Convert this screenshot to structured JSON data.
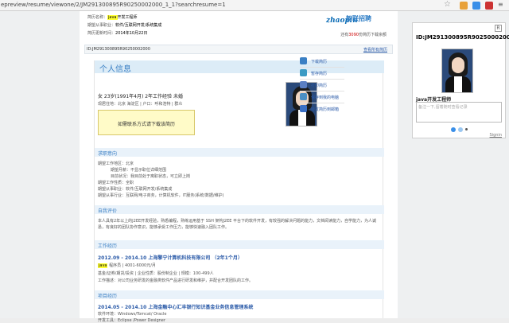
{
  "browser": {
    "url": "epreview/resume/viewone/2/JM291300895R90250002000_1_1?searchresume=1",
    "extension_colors": [
      "#e8a13a",
      "#3a8fe8",
      "#c33"
    ]
  },
  "header": {
    "position_name_label": "简历名称：",
    "position_name_hl": "java",
    "position_name_rest": "开发工程师",
    "intended_label": "期望从事职业：",
    "intended_value": "软件/互联网开发/系统集成",
    "updated_label": "简历更新时间：",
    "updated_value": "2014年10月22日",
    "logo_text": "zhaopin",
    "logo_cn": "智联招聘",
    "more_text_pre": "还有",
    "more_count": "3090",
    "more_text_post": "份简历下载余额"
  },
  "idbar": {
    "id_text": "ID:JM291300895R90250002000",
    "all_link": "查看所有简历"
  },
  "resume": {
    "title": "个人信息",
    "basic_line": "女  23岁(1991年4月)  2年工作经验  未婚",
    "location_line": "现居住地：北京 海淀区 | 户口：呼和浩特 | 群众",
    "contact_text": "如需联系方式请下载该简历",
    "sections": {
      "intent": "求职意向",
      "self_eval": "自我评价",
      "work": "工作经历",
      "project": "项目经历"
    },
    "intent_lines": [
      "期望工作地区：北京",
      "期望月薪：不显示职位详细范围",
      "目前状况：我目前处于离职状态，可立即上岗",
      "期望工作性质：全职",
      "期望从事职业：软件/互联网开发/系统集成",
      "期望从事行业：互联网/电子商务，计算机软件，IT服务(系统/数据/维护)"
    ],
    "self_eval_text": "本人具有2年以上的J2EE开发经验，熟悉编程，熟练运用基于 SSH 架构J2EE 平台下的软件开发，有较强的解决问题的能力，文档阅读能力，自学能力，为人诚恳，有良好的团队协作意识，能够承受工作压力，能够快速融入团队工作。",
    "job_title": "2012.09 - 2014.10  上海擎宁计算机科技有限公司  （2年1个月）",
    "job_hl": "java",
    "job_sub": "程序员 | 4001-6000元/月",
    "job_meta": "基金/证券/期货/投资 | 企业性质：股份制企业 | 规模：100-499人",
    "job_desc": "工作描述：对公司业务研发的金融类软件产品进行研发和维护，并配合开发团队的工作。",
    "project_title": "2014.05 - 2014.10  上海金融中心汇丰银行知识基金业务信息管理系统",
    "project_env": "软件环境：Windows/Tomcat/ Oracle",
    "project_tools": "开发工具：Eclipse /Power Designer"
  },
  "toolbar": {
    "items": [
      "下载简历",
      "暂存简历",
      "打印简历",
      "保存到我的电脑",
      "转发简历到邮箱"
    ],
    "icon_colors": [
      "#3a7fc4",
      "#3a9ac4",
      "#5a7fc4",
      "#4a8fc4",
      "#3a6fc4"
    ]
  },
  "side_card": {
    "r_label": "R",
    "id": "ID:JM291300895R90250002000",
    "title": "java开发工程师",
    "note_placeholder": "备注一下,留着随时查看记录",
    "signin": "Signin",
    "dot_colors": [
      "#3a8fe8",
      "#9bc7f0",
      "#555"
    ]
  }
}
